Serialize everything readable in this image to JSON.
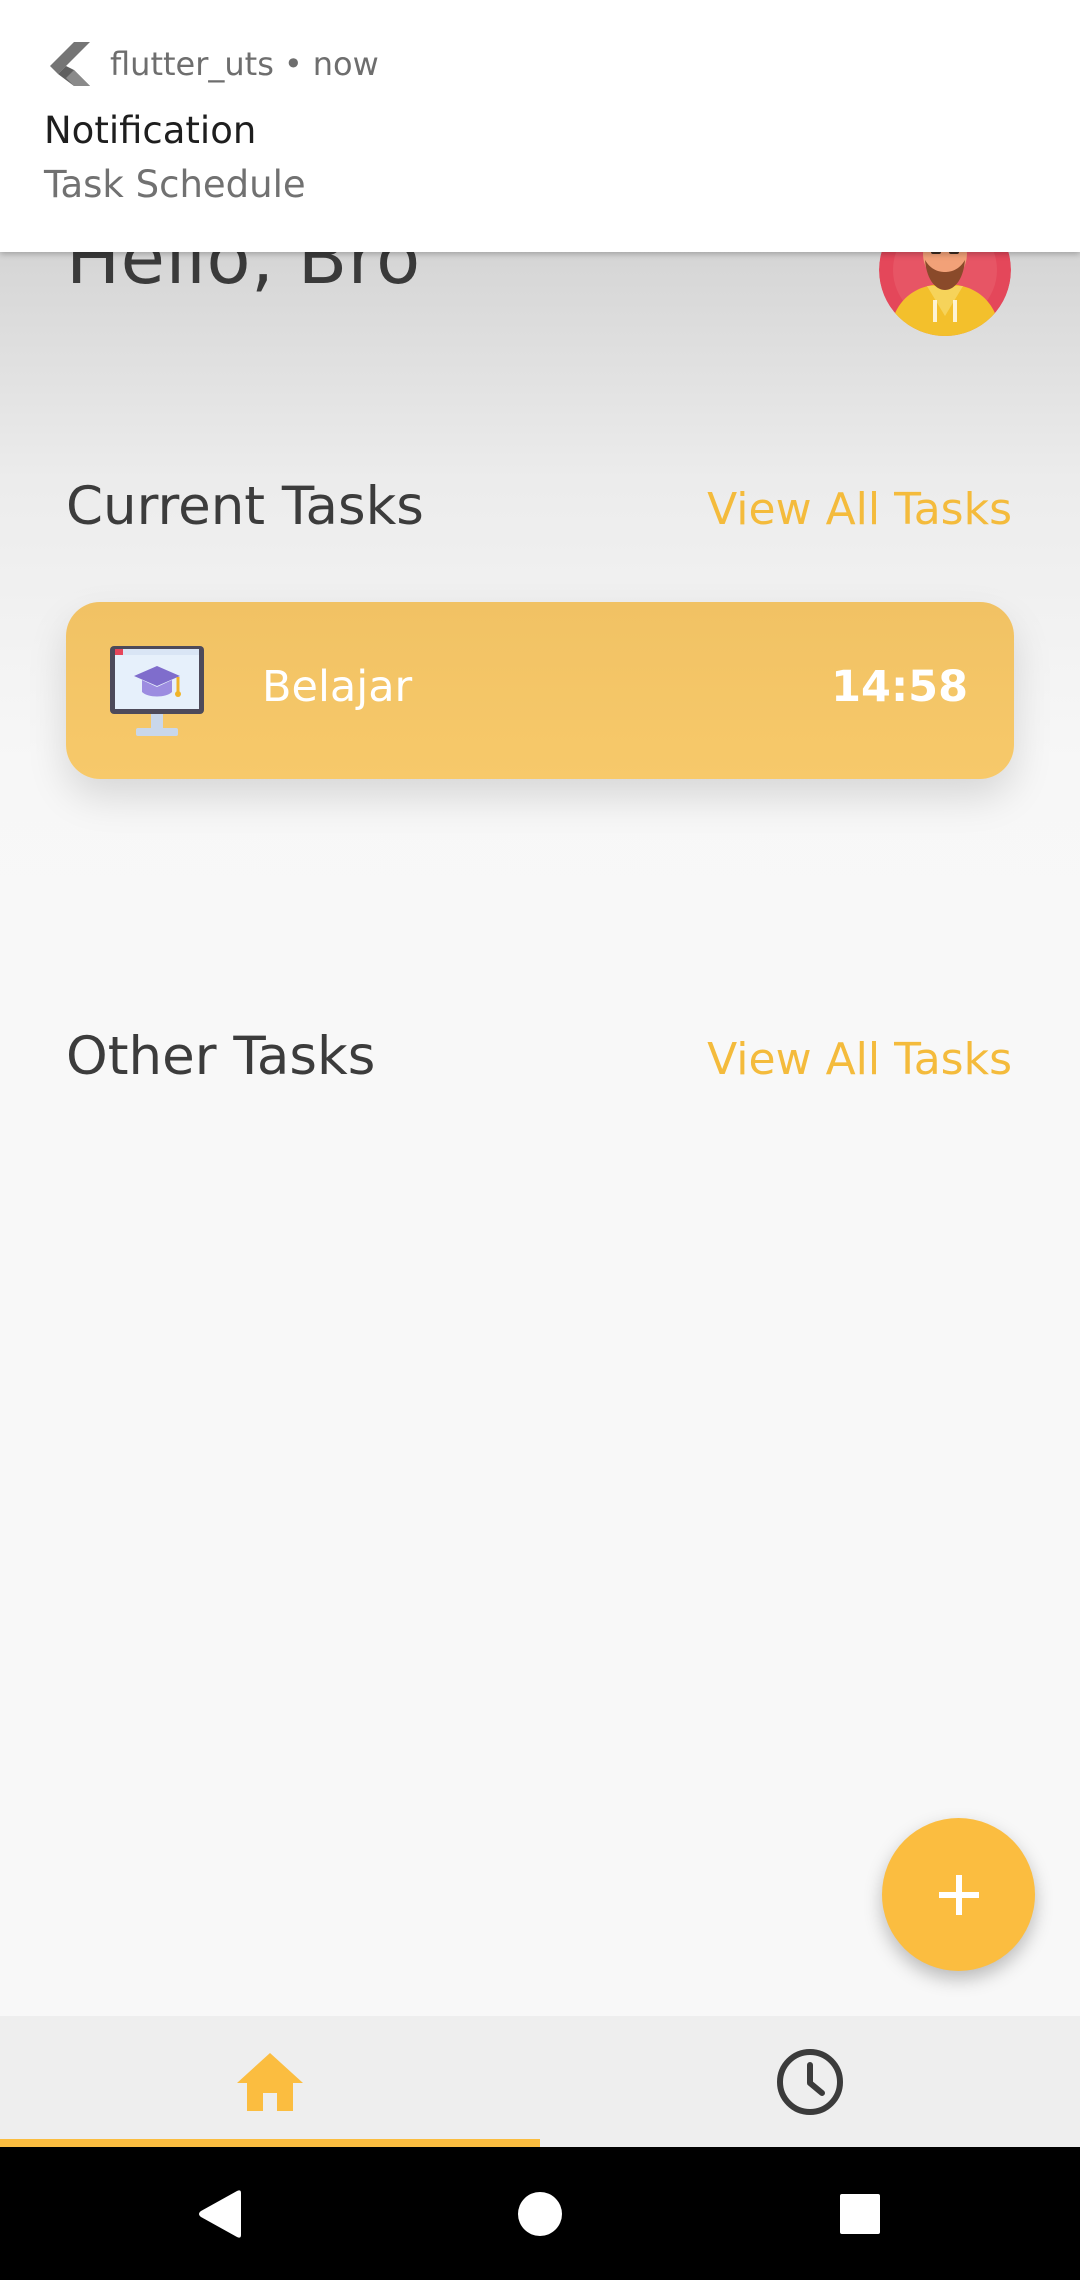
{
  "notification": {
    "app_name": "flutter_uts",
    "separator": "•",
    "time": "now",
    "title": "Notification",
    "text": "Task Schedule"
  },
  "header": {
    "greeting": "Hello, Bro"
  },
  "current_tasks": {
    "title": "Current Tasks",
    "view_all": "View All Tasks",
    "items": [
      {
        "name": "Belajar",
        "time": "14:58",
        "icon": "graduation-monitor-icon"
      }
    ]
  },
  "other_tasks": {
    "title": "Other Tasks",
    "view_all": "View All Tasks"
  },
  "fab": {
    "icon": "plus-icon"
  },
  "bottom_nav": {
    "items": [
      {
        "icon": "home-icon",
        "active": true
      },
      {
        "icon": "clock-icon",
        "active": false
      }
    ]
  },
  "system_nav": {
    "items": [
      "back-icon",
      "home-circle-icon",
      "recents-icon"
    ]
  },
  "colors": {
    "accent": "#fbbd40",
    "link": "#f4bb3c",
    "card": "#f5c668",
    "text": "#3a3a3a"
  }
}
